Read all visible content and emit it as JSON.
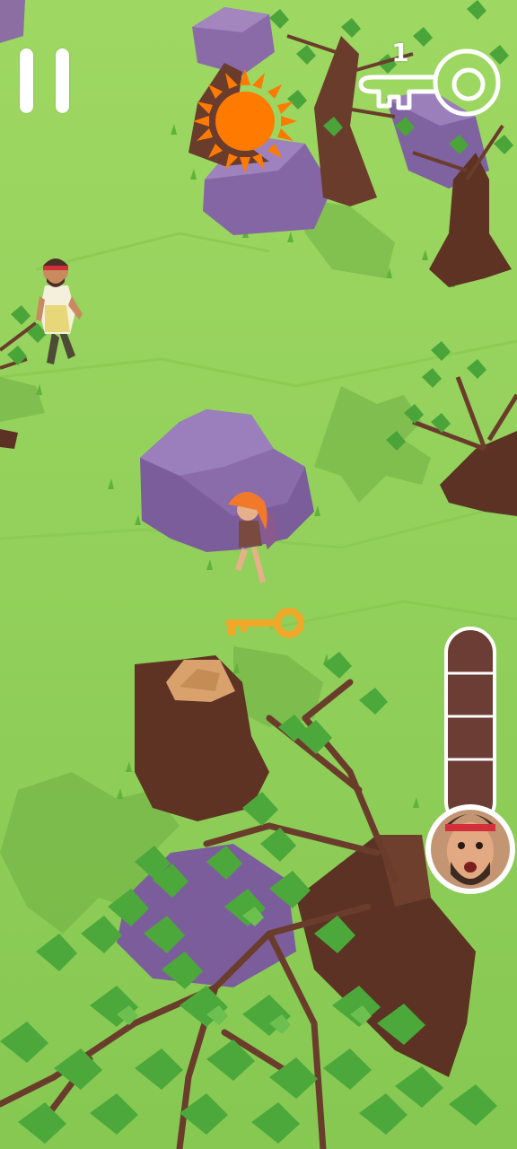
{
  "hud": {
    "keys_collected": "1",
    "danger_level": 0.0
  },
  "icons": {
    "pause": "pause-icon",
    "key_counter": "key-outline-icon",
    "sun": "sun-icon",
    "key_pickup": "golden-key-icon",
    "pursuer": "pursuer-avatar"
  },
  "colors": {
    "grass": "#8fd05a",
    "sun": "#fe7a00",
    "key": "#f0a82a",
    "meter": "#6b3d35"
  }
}
